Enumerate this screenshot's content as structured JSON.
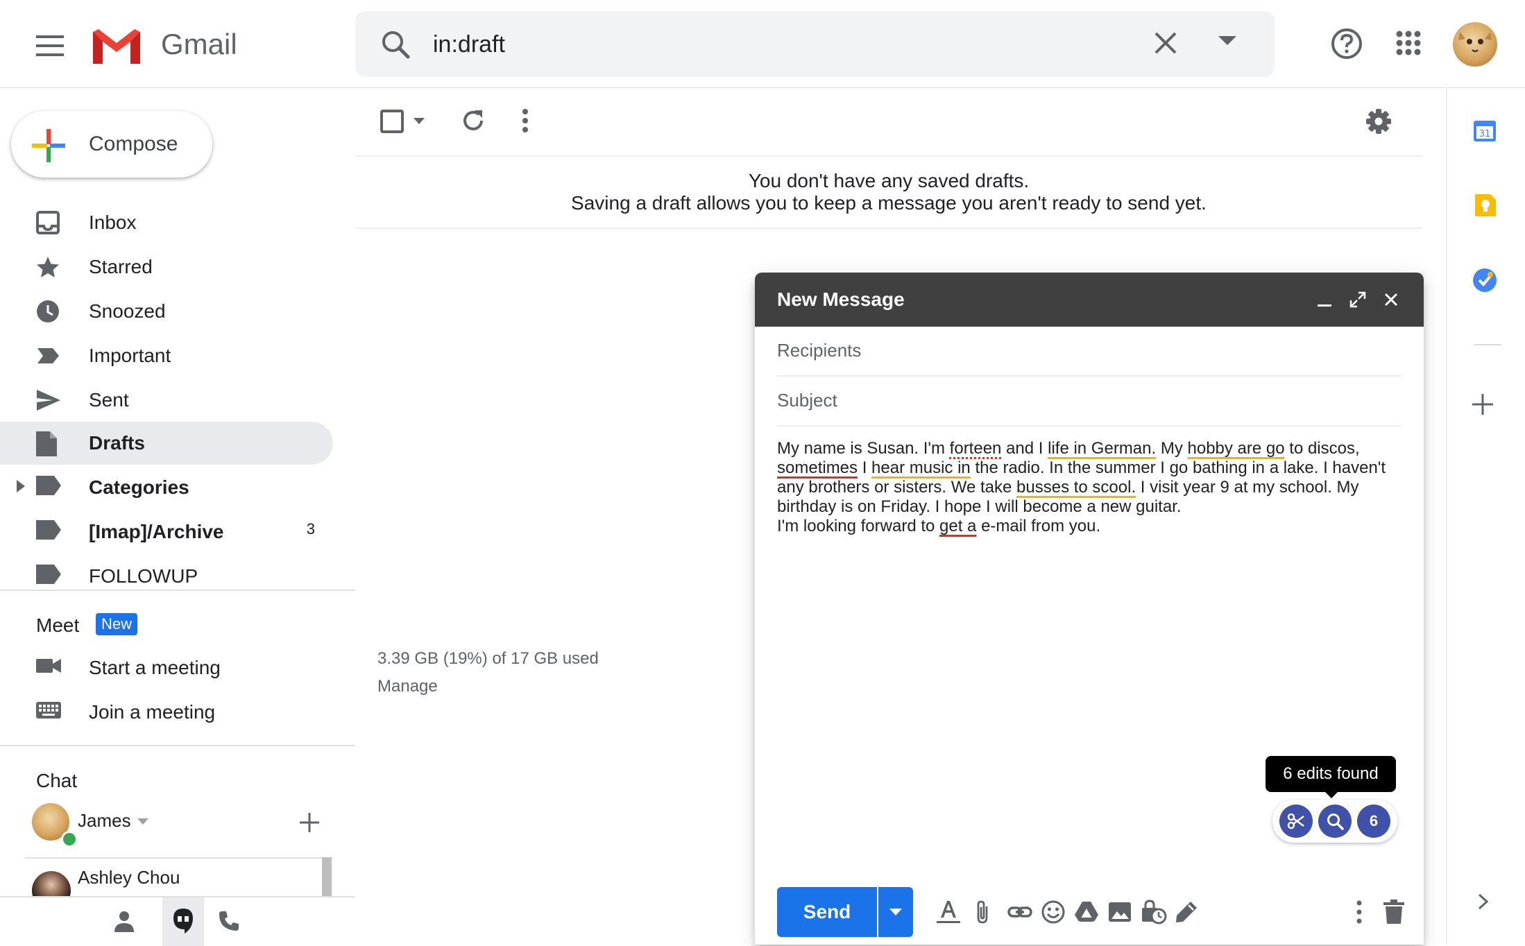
{
  "app": {
    "name": "Gmail"
  },
  "search": {
    "query": "in:draft"
  },
  "compose_button": {
    "label": "Compose"
  },
  "sidebar": {
    "items": [
      {
        "label": "Inbox"
      },
      {
        "label": "Starred"
      },
      {
        "label": "Snoozed"
      },
      {
        "label": "Important"
      },
      {
        "label": "Sent"
      },
      {
        "label": "Drafts"
      },
      {
        "label": "Categories"
      },
      {
        "label": "[Imap]/Archive",
        "count": "3"
      },
      {
        "label": "FOLLOWUP"
      }
    ]
  },
  "meet": {
    "title": "Meet",
    "badge": "New",
    "items": [
      {
        "label": "Start a meeting"
      },
      {
        "label": "Join a meeting"
      }
    ]
  },
  "chat": {
    "title": "Chat",
    "user": "James",
    "contacts": [
      {
        "name": "Ashley Chou"
      }
    ]
  },
  "main": {
    "empty_line1": "You don't have any saved drafts.",
    "empty_line2": "Saving a draft allows you to keep a message you aren't ready to send yet.",
    "storage": "3.39 GB (19%) of 17 GB used",
    "manage": "Manage"
  },
  "compose": {
    "title": "New Message",
    "recipients_placeholder": "Recipients",
    "subject_placeholder": "Subject",
    "body": {
      "s1": "My name is Susan. I'm ",
      "s2": "forteen",
      "s3": " and I ",
      "s4": "life in German.",
      "s5": " My ",
      "s6": "hobby are go",
      "s7": " to discos,",
      "s8": "sometimes",
      "s9": " I ",
      "s10": "hear music in",
      "s11": " the radio. In the summer I go bathing in a lake. I haven't",
      "s12": "any brothers or sisters. We take ",
      "s13": "busses to scool.",
      "s14": " I visit year 9 at my school. My",
      "s15": "birthday is on Friday. I hope I will become a new guitar.",
      "s16": "I'm looking forward to ",
      "s17": "get a",
      "s18": " e-mail from you."
    },
    "tooltip": "6 edits found",
    "edits_count": "6",
    "send_label": "Send"
  },
  "colors": {
    "accent": "#1a73e8",
    "compose_header": "#404040",
    "grammar_button": "#3f51a8",
    "spelling_underline": "#d93025",
    "grammar_underline": "#f2b600"
  }
}
